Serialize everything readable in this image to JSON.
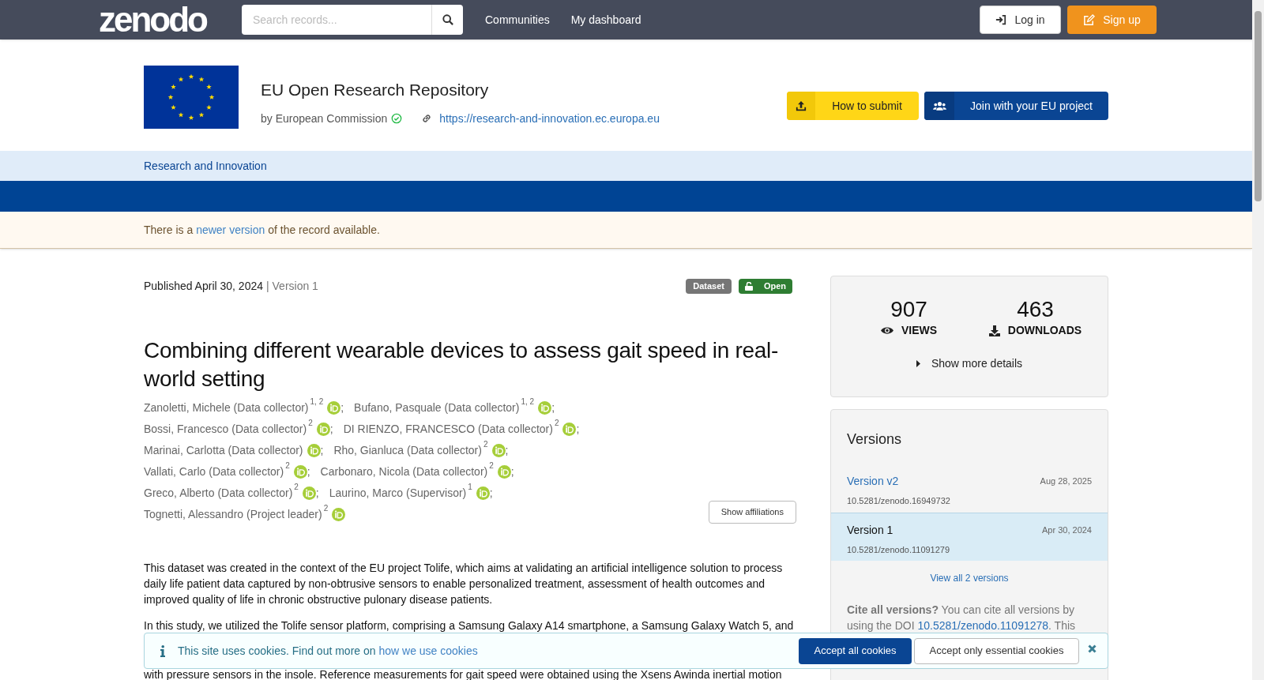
{
  "nav": {
    "logo": "zenodo",
    "search": {
      "placeholder": "Search records..."
    },
    "links": [
      "Communities",
      "My dashboard"
    ],
    "login": "Log in",
    "signup": "Sign up"
  },
  "community": {
    "title": "EU Open Research Repository",
    "by": "by European Commission",
    "verified": true,
    "url": "https://research-and-innovation.ec.europa.eu",
    "buttons": [
      {
        "kind": "submit",
        "label": "How to submit"
      },
      {
        "kind": "join",
        "label": "Join with your EU project"
      }
    ],
    "menu": [
      "Research and Innovation"
    ]
  },
  "notice": {
    "before": "There is a",
    "link": "newer version",
    "after": "of the record available."
  },
  "record": {
    "published": "Published April 30, 2024",
    "version": "| Version 1",
    "badges": [
      {
        "kind": "type",
        "label": "Dataset"
      },
      {
        "kind": "access",
        "label": "Open"
      }
    ],
    "title": "Combining different wearable devices to assess gait speed in real-world setting",
    "creator_rows": [
      [
        {
          "name": "Zanoletti, Michele (Data collector)",
          "affiliations": "1, 2",
          "sep": ";"
        },
        {
          "name": "Bufano, Pasquale (Data collector)",
          "affiliations": "1, 2",
          "sep": ";"
        }
      ],
      [
        {
          "name": "Bossi, Francesco (Data collector)",
          "affiliations": "2",
          "sep": ";"
        },
        {
          "name": "DI RIENZO, FRANCESCO (Data collector)",
          "affiliations": "2",
          "sep": ";"
        }
      ],
      [
        {
          "name": "Marinai, Carlotta (Data collector)",
          "sep": ";"
        },
        {
          "name": "Rho, Gianluca (Data collector)",
          "affiliations": "2",
          "sep": ";"
        }
      ],
      [
        {
          "name": "Vallati, Carlo (Data collector)",
          "affiliations": "2",
          "sep": ";"
        },
        {
          "name": "Carbonaro, Nicola (Data collector)",
          "affiliations": "2",
          "sep": ";"
        }
      ],
      [
        {
          "name": "Greco, Alberto (Data collector)",
          "affiliations": "2",
          "sep": ";"
        },
        {
          "name": "Laurino, Marco (Supervisor)",
          "affiliations": "1",
          "sep": ";"
        }
      ],
      [
        {
          "name": "Tognetti, Alessandro (Project leader)",
          "affiliations": "2"
        }
      ]
    ],
    "show_affiliations": "Show affiliations",
    "description": [
      "This dataset was created in the context of the EU project Tolife, which aims at validating an artificial intelligence solution to process daily life patient data captured by non-obtrusive sensors to enable personalized treatment, assessment of health outcomes and improved quality of life in chronic obstructive pulonary disease patients.",
      "In this study, we utilized the Tolife sensor platform, comprising a Samsung Galaxy A14 smartphone, a Samsung Galaxy Watch 5, and",
      "with pressure sensors in the insole. Reference measurements for gait speed were obtained using the Xsens Awinda inertial motion"
    ]
  },
  "stats": {
    "views": "907",
    "views_label": "VIEWS",
    "downloads": "463",
    "downloads_label": "DOWNLOADS",
    "more": "Show more details"
  },
  "versions": {
    "title": "Versions",
    "items": [
      {
        "label": "Version v2",
        "date": "Aug 28, 2025",
        "doi": "10.5281/zenodo.16949732",
        "selected": false
      },
      {
        "label": "Version 1",
        "date": "Apr 30, 2024",
        "doi": "10.5281/zenodo.11091279",
        "selected": true
      }
    ],
    "view_all": "View all 2 versions",
    "cite_before": "**Cite all versions?** You can cite all versions by using the DOI",
    "cite_doi": "10.5281/zenodo.11091278",
    "cite_after": ". This"
  },
  "cookies": {
    "text": "This site uses cookies. Find out more on",
    "link": "how we use cookies",
    "accept_all": "Accept all cookies",
    "accept_essential": "Accept only essential cookies"
  }
}
